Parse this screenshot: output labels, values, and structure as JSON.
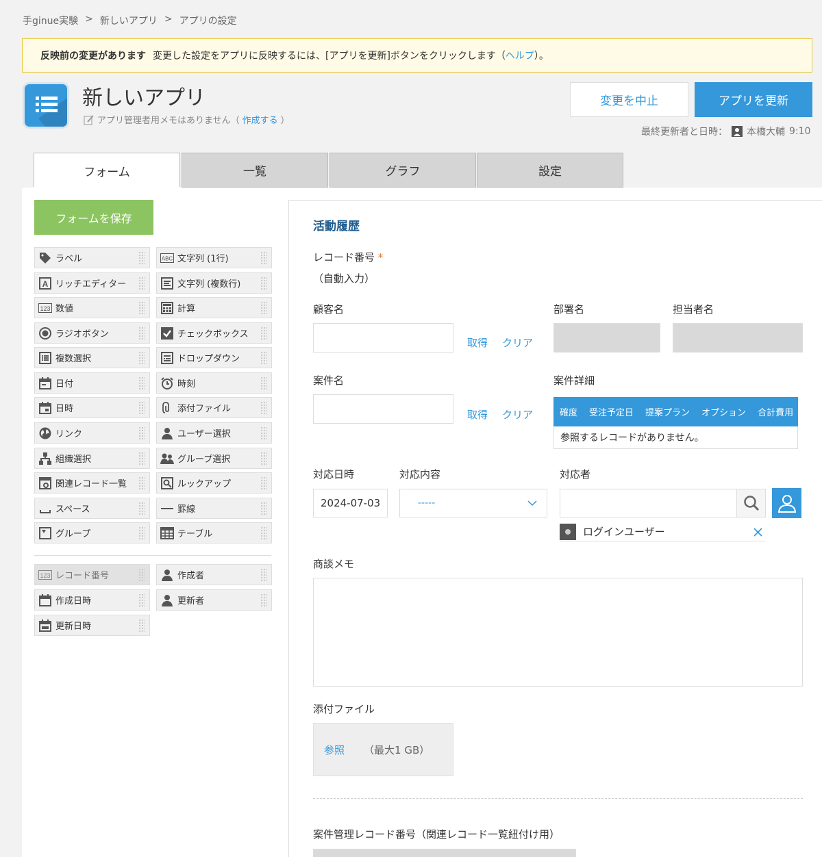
{
  "breadcrumb": {
    "items": [
      "手ginue実験",
      "新しいアプリ",
      "アプリの設定"
    ],
    "sep": ">"
  },
  "notice": {
    "title": "反映前の変更があります",
    "text": "変更した設定をアプリに反映するには、[アプリを更新]ボタンをクリックします（",
    "help": "ヘルプ",
    "text_end": "）。"
  },
  "app": {
    "title": "新しいアプリ",
    "memo": "アプリ管理者用メモはありません（",
    "memo_link": "作成する",
    "memo_end": "）",
    "cancel_label": "変更を中止",
    "update_label": "アプリを更新",
    "last_updated_label": "最終更新者と日時：",
    "last_updated_user": "本橋大輔",
    "last_updated_time": "9:10"
  },
  "tabs": [
    {
      "label": "フォーム",
      "active": true
    },
    {
      "label": "一覧",
      "active": false
    },
    {
      "label": "グラフ",
      "active": false
    },
    {
      "label": "設定",
      "active": false
    }
  ],
  "palette": {
    "save_label": "フォームを保存",
    "left": [
      "ラベル",
      "リッチエディター",
      "数値",
      "ラジオボタン",
      "複数選択",
      "日付",
      "日時",
      "リンク",
      "組織選択",
      "関連レコード一覧",
      "スペース",
      "グループ"
    ],
    "right": [
      "文字列 (1行)",
      "文字列 (複数行)",
      "計算",
      "チェックボックス",
      "ドロップダウン",
      "時刻",
      "添付ファイル",
      "ユーザー選択",
      "グループ選択",
      "ルックアップ",
      "罫線",
      "テーブル"
    ],
    "system_left": [
      "レコード番号",
      "作成日時",
      "更新日時"
    ],
    "system_right": [
      "作成者",
      "更新者"
    ]
  },
  "form": {
    "section_title": "活動履歴",
    "record_no_label": "レコード番号",
    "required_mark": "*",
    "record_no_value": "（自動入力）",
    "customer_label": "顧客名",
    "department_label": "部署名",
    "person_label": "担当者名",
    "get_label": "取得",
    "clear_label": "クリア",
    "case_label": "案件名",
    "case_detail_label": "案件詳細",
    "case_table_headers": [
      "確度",
      "受注予定日",
      "提案プラン",
      "オプション",
      "合計費用"
    ],
    "case_table_empty": "参照するレコードがありません。",
    "date_label": "対応日時",
    "date_value": "2024-07-03",
    "content_label": "対応内容",
    "content_value": "-----",
    "responder_label": "対応者",
    "responder_chip": "ログインユーザー",
    "memo_label": "商談メモ",
    "attach_label": "添付ファイル",
    "attach_browse": "参照",
    "attach_max": "（最大1 GB）",
    "case_record_label": "案件管理レコード番号（関連レコード一覧紐付け用）"
  },
  "colors": {
    "accent": "#3498db",
    "save": "#8cc461",
    "notice_bg": "#fffbe6",
    "notice_border": "#e8c83c",
    "required": "#e0793b"
  }
}
